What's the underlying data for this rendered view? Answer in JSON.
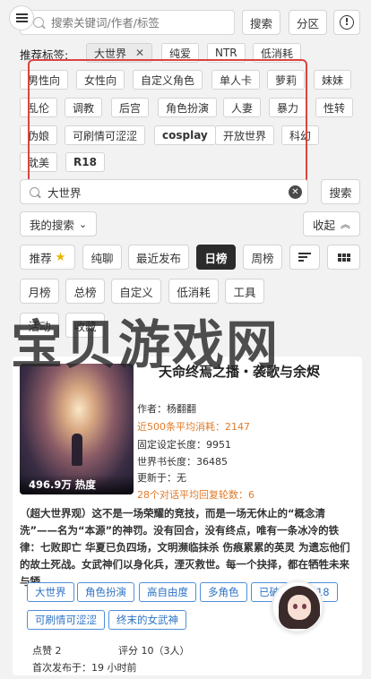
{
  "search": {
    "placeholder": "搜索关键词/作者/标签",
    "search_btn": "搜索",
    "category_btn": "分区",
    "help_icon": "!"
  },
  "recommended": {
    "label": "推荐标签:",
    "selected_tags": [
      {
        "label": "大世界",
        "close": "✕"
      }
    ],
    "tags_row0": [
      "纯爱",
      "NTR",
      "低消耗"
    ],
    "tags": [
      "男性向",
      "女性向",
      "自定义角色",
      "单人卡",
      "萝莉",
      "妹妹",
      "乱伦",
      "调教",
      "后宫",
      "角色扮演",
      "人妻",
      "暴力",
      "性转",
      "伪娘",
      "可刷情可涩涩",
      "cosplay",
      "开放世界",
      "科幻",
      "耽美",
      "R18"
    ]
  },
  "filter": {
    "value": "大世界",
    "search_btn": "搜索",
    "clear_icon": "✕"
  },
  "my_search": {
    "label": "我的搜索",
    "collapse": "收起"
  },
  "sort": {
    "row1": [
      "推荐",
      "纯聊",
      "最近发布",
      "日榜",
      "周榜"
    ],
    "active": "日榜",
    "row2": [
      "月榜",
      "总榜",
      "自定义",
      "低消耗",
      "工具"
    ],
    "row3": [
      "活动",
      "收藏"
    ]
  },
  "watermark": "宝贝游戏网",
  "card": {
    "title": "天命终焉之播・袭歌与余烬",
    "hot": "496.9万 热度",
    "author": "作者：杨翻翻",
    "avg_cost": "近500条平均消耗：2147",
    "fixed_len": "固定设定长度：9951",
    "world_len": "世界书长度：36485",
    "updated": "更新于：无",
    "avg_rounds": "28个对话平均回复轮数：6",
    "desc": "（超大世界观）这不是一场荣耀的竞技，而是一场无休止的“概念清洗”——名为“本源”的神罚。没有回合，没有终点，唯有一条冰冷的铁律：七败即亡 华夏已负四场，文明濒临抹杀 伤痕累累的英灵 为遗忘他们的故土死战。女武神们以身化兵，湮灭救世。每一个抉择，都在牺牲未来与牺...",
    "chips": [
      "大世界",
      "角色扮演",
      "高自由度",
      "多角色",
      "已破限",
      "R18",
      "可刷情可涩涩",
      "终末的女武神"
    ],
    "likes": "点赞 2",
    "score": "评分 10（3人）",
    "first_pub": "首次发布于：19 小时前"
  },
  "colors": {
    "accent_red": "#d9453f",
    "chip_blue": "#2d72c4",
    "orange": "#e07b2a",
    "active_btn": "#2b2b2b"
  }
}
